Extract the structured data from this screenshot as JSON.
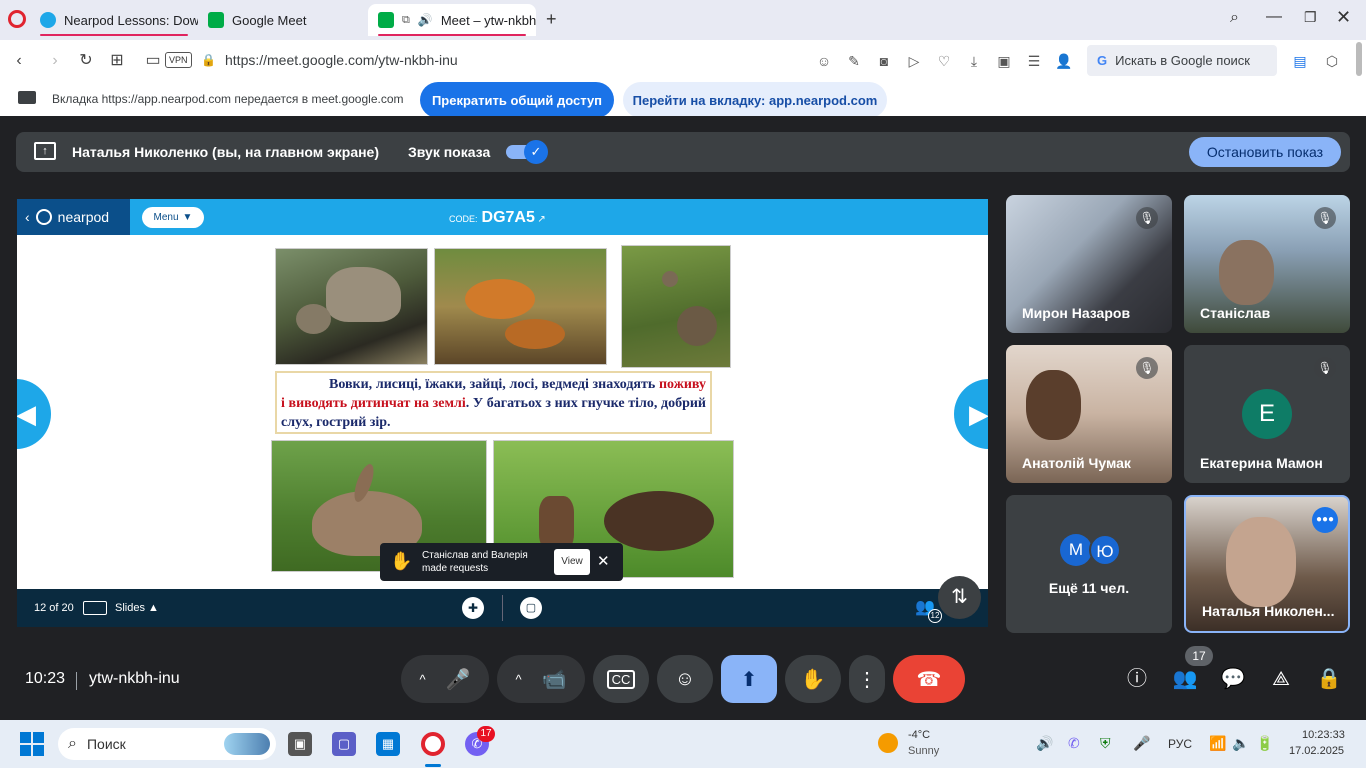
{
  "browser": {
    "tabs": [
      {
        "title": "Nearpod Lessons: Downlo"
      },
      {
        "title": "Google Meet"
      },
      {
        "title": "Meet – ytw-nkbh-i"
      }
    ],
    "new_tab": "+",
    "vpn": "VPN",
    "url": "https://meet.google.com/ytw-nkbh-inu",
    "search_placeholder": "Искать в Google поиск"
  },
  "share_banner": {
    "text": "Вкладка https://app.nearpod.com передается в meet.google.com",
    "stop_label": "Прекратить общий доступ",
    "switch_label": "Перейти на вкладку: app.nearpod.com"
  },
  "presentation_bar": {
    "presenter": "Наталья Николенко (вы, на главном экране)",
    "sound_label": "Звук показа",
    "stop_label": "Остановить показ"
  },
  "nearpod": {
    "logo": "nearpod",
    "menu": "Menu",
    "code_label": "CODE:",
    "code": "DG7A5",
    "slide_text_1": "Вовки, лисиці, їжаки, зайці, лосі, ведмеді знаходять",
    "slide_text_red": "поживу і виводять дитинчат на землі",
    "slide_text_2": ". У багатьох з них гнучке тіло, добрий слух, гострий зір.",
    "slide_counter": "12 of 20",
    "slides_label": "Slides",
    "toast_text": "Станіслав and Валерія made requests",
    "toast_view": "View",
    "participants_count": "12"
  },
  "participants": [
    {
      "name": "Мирон Назаров"
    },
    {
      "name": "Станіслав"
    },
    {
      "name": "Анатолій Чумак"
    },
    {
      "name": "Екатерина Мамон",
      "initial": "E"
    },
    {
      "name": "Ещё 11 чел.",
      "initials": [
        "M",
        "Ю"
      ]
    },
    {
      "name": "Наталья Николен..."
    }
  ],
  "bottom_bar": {
    "time": "10:23",
    "meeting_code": "ytw-nkbh-inu",
    "people_badge": "17"
  },
  "taskbar": {
    "search": "Поиск",
    "viber_badge": "17",
    "weather_temp": "-4°C",
    "weather_desc": "Sunny",
    "lang": "РУС",
    "time": "10:23:33",
    "date": "17.02.2025"
  },
  "colors": {
    "meet_bg": "#202124",
    "accent": "#8ab4f8",
    "hangup": "#ea4335",
    "nearpod_blue": "#1ea7e8"
  }
}
